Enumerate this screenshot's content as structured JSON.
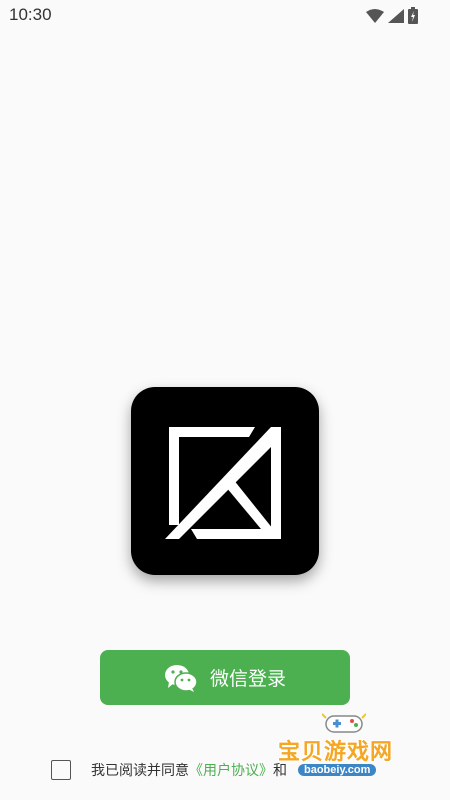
{
  "status_bar": {
    "time": "10:30",
    "icons": [
      "wifi-icon",
      "signal-icon",
      "battery-icon"
    ]
  },
  "logo": {
    "name": "app-logo",
    "colors": {
      "background": "#000000",
      "mark": "#ffffff"
    }
  },
  "login": {
    "button_label": "微信登录",
    "icon": "wechat-icon",
    "color": "#4caf50"
  },
  "agreement": {
    "prefix": "我已阅读并同意",
    "user_agreement": "《用户协议》",
    "connector": "和"
  },
  "watermark": {
    "text": "宝贝游戏网",
    "url": "baobeiy.com"
  }
}
